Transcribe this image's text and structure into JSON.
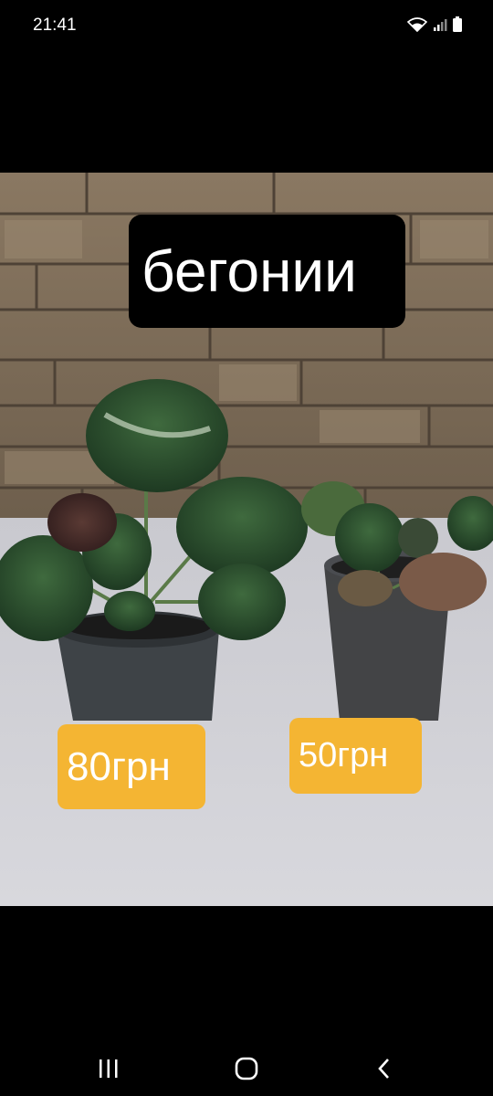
{
  "status_bar": {
    "time": "21:41",
    "icons": [
      "wifi-icon",
      "signal-icon",
      "battery-icon"
    ]
  },
  "photo": {
    "title": "бегонии",
    "prices": [
      {
        "label": "80грн"
      },
      {
        "label": "50грн"
      }
    ],
    "colors": {
      "price_tag": "#f4b533",
      "title_bg": "#000000"
    }
  },
  "nav_bar": {
    "buttons": [
      "recent-apps-icon",
      "home-icon",
      "back-icon"
    ]
  }
}
